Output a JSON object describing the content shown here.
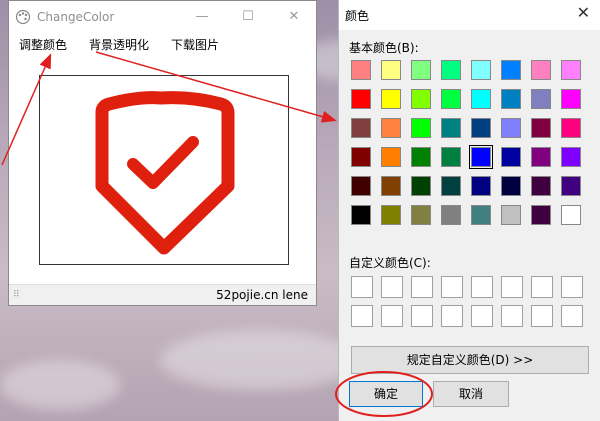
{
  "main_window": {
    "title": "ChangeColor",
    "minimize_glyph": "—",
    "maximize_glyph": "☐",
    "close_glyph": "✕",
    "menu": [
      {
        "label": "调整颜色"
      },
      {
        "label": "背景透明化"
      },
      {
        "label": "下载图片"
      }
    ],
    "status_text": "52pojie.cn lene",
    "shield_color": "#e0200e"
  },
  "color_dialog": {
    "title": "颜色",
    "close_glyph": "✕",
    "basic_label": "基本颜色(B):",
    "custom_label": "自定义颜色(C):",
    "define_button": "规定自定义颜色(D) >>",
    "ok_button": "确定",
    "cancel_button": "取消",
    "selected_index": 28,
    "basic_colors": [
      "#ff8080",
      "#ffff80",
      "#80ff80",
      "#00ff80",
      "#80ffff",
      "#0080ff",
      "#ff80c0",
      "#ff80ff",
      "#ff0000",
      "#ffff00",
      "#80ff00",
      "#00ff40",
      "#00ffff",
      "#0080c0",
      "#8080c0",
      "#ff00ff",
      "#804040",
      "#ff8040",
      "#00ff00",
      "#008080",
      "#004080",
      "#8080ff",
      "#800040",
      "#ff0080",
      "#800000",
      "#ff8000",
      "#008000",
      "#008040",
      "#0000ff",
      "#0000a0",
      "#800080",
      "#8000ff",
      "#400000",
      "#804000",
      "#004000",
      "#004040",
      "#000080",
      "#000040",
      "#400040",
      "#400080",
      "#000000",
      "#808000",
      "#808040",
      "#808080",
      "#408080",
      "#c0c0c0",
      "#400040",
      "#ffffff"
    ],
    "custom_colors": [
      "#ffffff",
      "#ffffff",
      "#ffffff",
      "#ffffff",
      "#ffffff",
      "#ffffff",
      "#ffffff",
      "#ffffff",
      "#ffffff",
      "#ffffff",
      "#ffffff",
      "#ffffff",
      "#ffffff",
      "#ffffff",
      "#ffffff",
      "#ffffff"
    ]
  },
  "annotations": {
    "color": "#e02020"
  }
}
